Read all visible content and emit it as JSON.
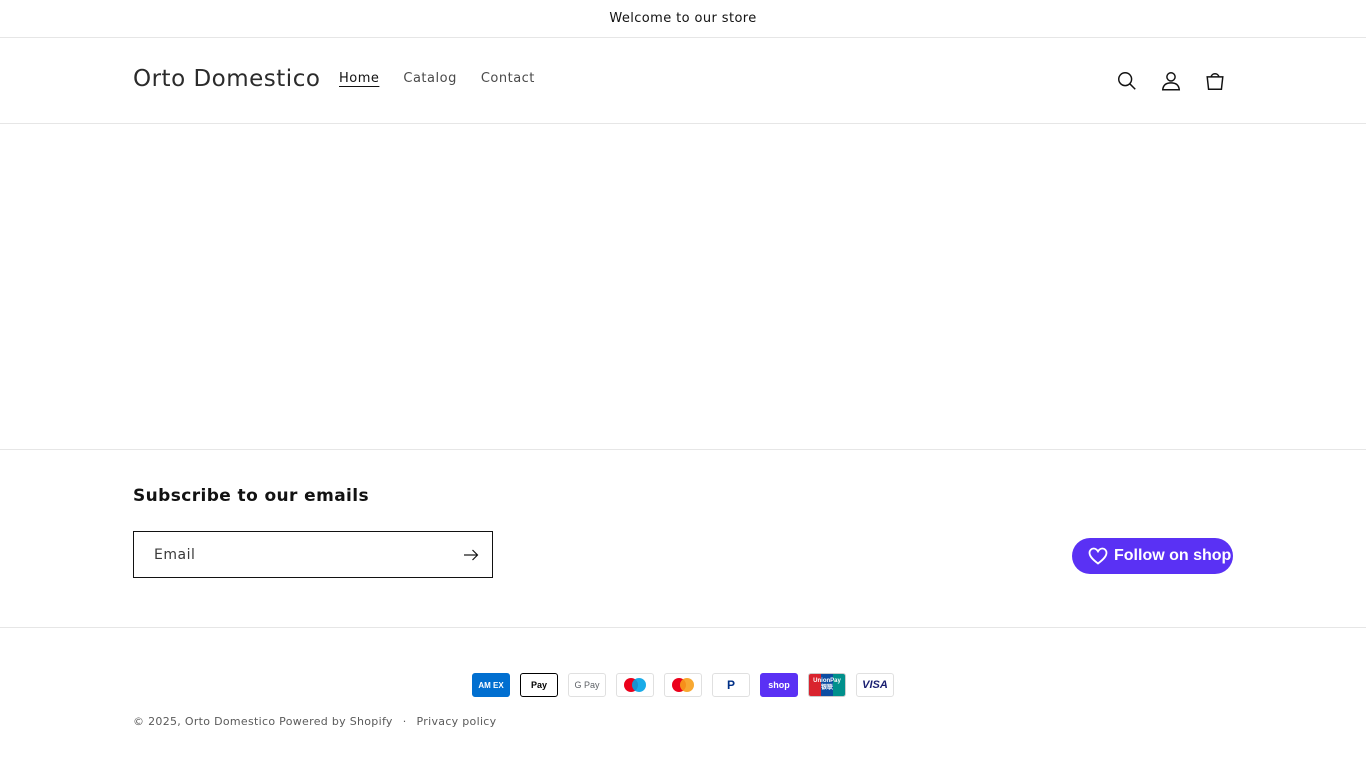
{
  "announcement": {
    "text": "Welcome to our store"
  },
  "header": {
    "logo": "Orto Domestico",
    "nav": [
      {
        "label": "Home",
        "active": true
      },
      {
        "label": "Catalog",
        "active": false
      },
      {
        "label": "Contact",
        "active": false
      }
    ],
    "icons": [
      "search-icon",
      "account-icon",
      "cart-icon"
    ]
  },
  "footer": {
    "newsletter": {
      "heading": "Subscribe to our emails",
      "placeholder": "Email",
      "submit_icon": "arrow-right-icon"
    },
    "follow_button": {
      "label": "Follow on shop",
      "icon": "heart-icon",
      "color": "#5a31f4"
    },
    "payments": {
      "amex": "AM EX",
      "apple_pay": " Pay",
      "google_pay": "G Pay",
      "maestro": "",
      "mastercard": "",
      "paypal": "P",
      "shop_pay": "shop",
      "unionpay_top": "UnionPay",
      "unionpay_bottom": "银联",
      "visa": "VISA"
    },
    "copyright_prefix": "© 2025,",
    "copyright_store": "Orto Domestico",
    "powered_by": "Powered by Shopify",
    "separator": "·",
    "privacy_policy": "Privacy policy"
  }
}
